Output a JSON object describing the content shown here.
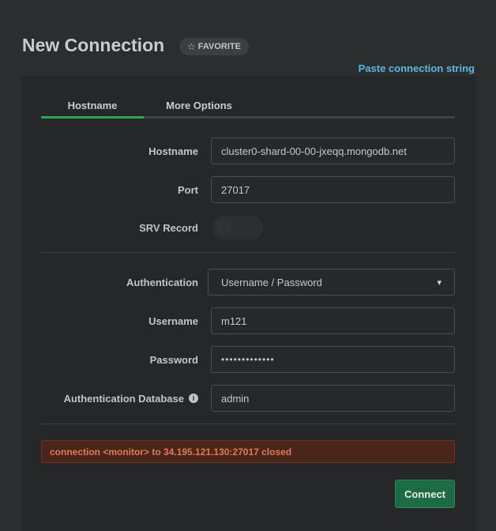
{
  "header": {
    "title": "New Connection",
    "favorite_label": "FAVORITE",
    "paste_link": "Paste connection string"
  },
  "tabs": [
    {
      "label": "Hostname",
      "active": true
    },
    {
      "label": "More Options",
      "active": false
    }
  ],
  "form": {
    "hostname": {
      "label": "Hostname",
      "value": "cluster0-shard-00-00-jxeqq.mongodb.net"
    },
    "port": {
      "label": "Port",
      "value": "27017"
    },
    "srv": {
      "label": "SRV Record",
      "enabled": false
    },
    "authentication": {
      "label": "Authentication",
      "selected": "Username / Password"
    },
    "username": {
      "label": "Username",
      "value": "m121"
    },
    "password": {
      "label": "Password",
      "value": "•••••••••••••"
    },
    "auth_db": {
      "label": "Authentication Database",
      "value": "admin"
    }
  },
  "error_message": "connection <monitor> to 34.195.121.130:27017 closed",
  "connect_label": "Connect",
  "colors": {
    "accent_green": "#2fa35b",
    "link_blue": "#5bb8dc",
    "error_text": "#e07b55",
    "error_bg": "#4a2519",
    "button_bg": "#1d6b45"
  }
}
